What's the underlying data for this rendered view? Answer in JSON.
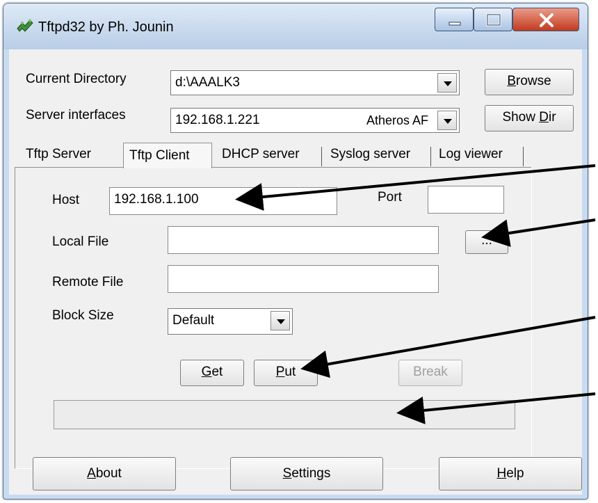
{
  "window": {
    "title": "Tftpd32 by Ph. Jounin",
    "icon": "tftpd32-app-icon"
  },
  "caption_buttons": {
    "minimize_icon": "minimize-icon",
    "maximize_icon": "maximize-icon",
    "close_icon": "close-icon"
  },
  "header": {
    "current_directory_label": "Current Directory",
    "current_directory_value": "d:\\AAALK3",
    "browse_button": {
      "pre": "",
      "u": "B",
      "post": "rowse"
    },
    "server_interfaces_label": "Server interfaces",
    "server_interfaces_ip": "192.168.1.221",
    "server_interfaces_adapter": "Atheros AF",
    "show_dir_button": {
      "pre": "Show ",
      "u": "D",
      "post": "ir"
    }
  },
  "tabs": [
    {
      "label": "Tftp Server",
      "active": false
    },
    {
      "label": "Tftp Client",
      "active": true
    },
    {
      "label": "DHCP server",
      "active": false
    },
    {
      "label": "Syslog server",
      "active": false
    },
    {
      "label": "Log viewer",
      "active": false
    }
  ],
  "client": {
    "host_label": "Host",
    "host_value": "192.168.1.100",
    "port_label": "Port",
    "port_value": "",
    "local_file_label": "Local File",
    "local_file_value": "",
    "browse_file_button": "...",
    "remote_file_label": "Remote File",
    "remote_file_value": "",
    "block_size_label": "Block Size",
    "block_size_value": "Default",
    "get_button": {
      "u": "G",
      "post": "et"
    },
    "put_button": {
      "u": "P",
      "post": "ut"
    },
    "break_button": "Break",
    "status_text": ""
  },
  "footer": {
    "about_button": {
      "u": "A",
      "post": "bout"
    },
    "settings_button": {
      "u": "S",
      "post": "ettings"
    },
    "help_button": {
      "u": "H",
      "post": "elp"
    }
  },
  "colors": {
    "titlebar": "#c9dbf0",
    "client_bg": "#f0f0f0",
    "close_button": "#c13b1f",
    "annotation_arrow": "#000000"
  }
}
